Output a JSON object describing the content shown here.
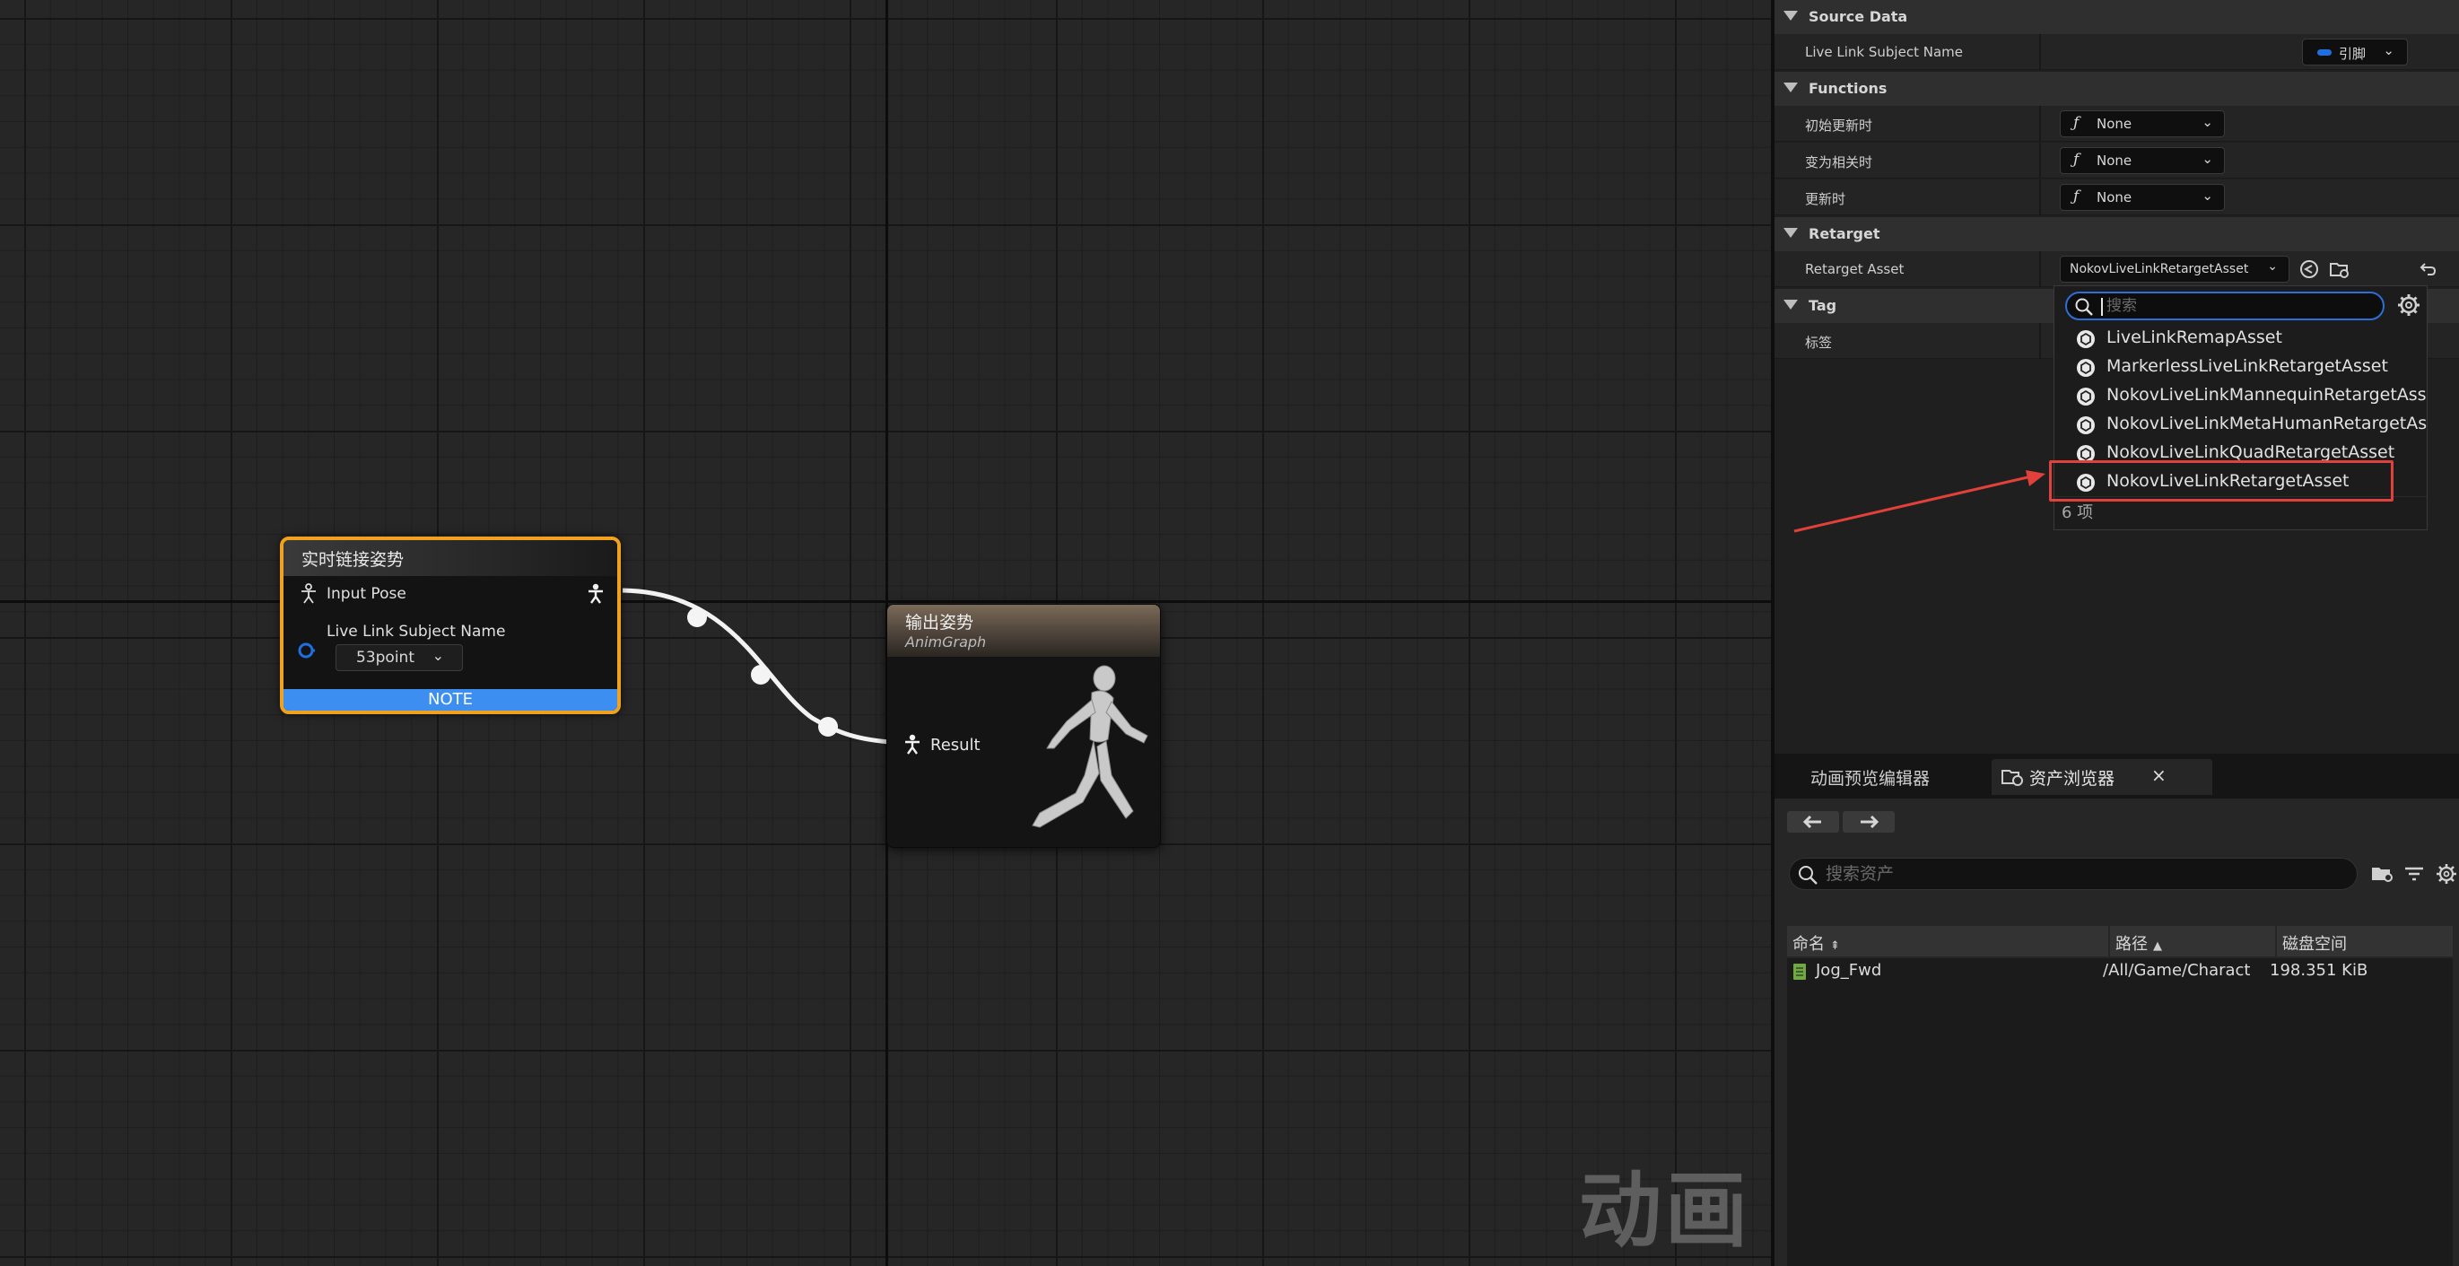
{
  "graph": {
    "node_livelink": {
      "title": "实时链接姿势",
      "input_pose_label": "Input Pose",
      "subject_label": "Live Link Subject Name",
      "subject_value": "53point",
      "note_label": "NOTE"
    },
    "node_output": {
      "title": "输出姿势",
      "subtitle": "AnimGraph",
      "result_label": "Result"
    },
    "watermark": "动画"
  },
  "details": {
    "sections": {
      "source_data": "Source Data",
      "functions": "Functions",
      "retarget": "Retarget",
      "tag": "Tag"
    },
    "live_link_subject_name": {
      "label": "Live Link Subject Name",
      "value": "引脚"
    },
    "functions": [
      {
        "label": "初始更新时",
        "value": "None"
      },
      {
        "label": "变为相关时",
        "value": "None"
      },
      {
        "label": "更新时",
        "value": "None"
      }
    ],
    "retarget_asset": {
      "label": "Retarget Asset",
      "value": "NokovLiveLinkRetargetAsset"
    },
    "tag_label": "标签"
  },
  "picker": {
    "search_placeholder": "搜索",
    "items": [
      "LiveLinkRemapAsset",
      "MarkerlessLiveLinkRetargetAsset",
      "NokovLiveLinkMannequinRetargetAsset",
      "NokovLiveLinkMetaHumanRetargetAsset",
      "NokovLiveLinkQuadRetargetAsset",
      "NokovLiveLinkRetargetAsset"
    ],
    "highlighted_item": "NokovLiveLinkRetargetAsset",
    "count": "6 项"
  },
  "browser": {
    "tab_preview": "动画预览编辑器",
    "tab_assets": "资产浏览器",
    "close_glyph": "×",
    "search_placeholder": "搜索资产",
    "columns": {
      "name": "命名",
      "path": "路径",
      "size": "磁盘空间"
    },
    "rows": [
      {
        "name": "Jog_Fwd",
        "path": "/All/Game/Charact",
        "size": "198.351 KiB"
      }
    ]
  },
  "colors": {
    "selected_node_border": "#f0a21e",
    "note_bar": "#3c8ff0",
    "search_focus": "#2d6fd6",
    "annotation_red": "#e1413a"
  },
  "icons": [
    "person-pin-icon",
    "live-link-pin-icon",
    "function-icon",
    "browse-icon",
    "use-selected-icon",
    "reset-arrow-icon",
    "search-icon",
    "gear-icon",
    "asset-class-icon",
    "folder-icon",
    "filter-icon",
    "back-arrow-icon",
    "forward-arrow-icon",
    "anim-sequence-icon"
  ]
}
